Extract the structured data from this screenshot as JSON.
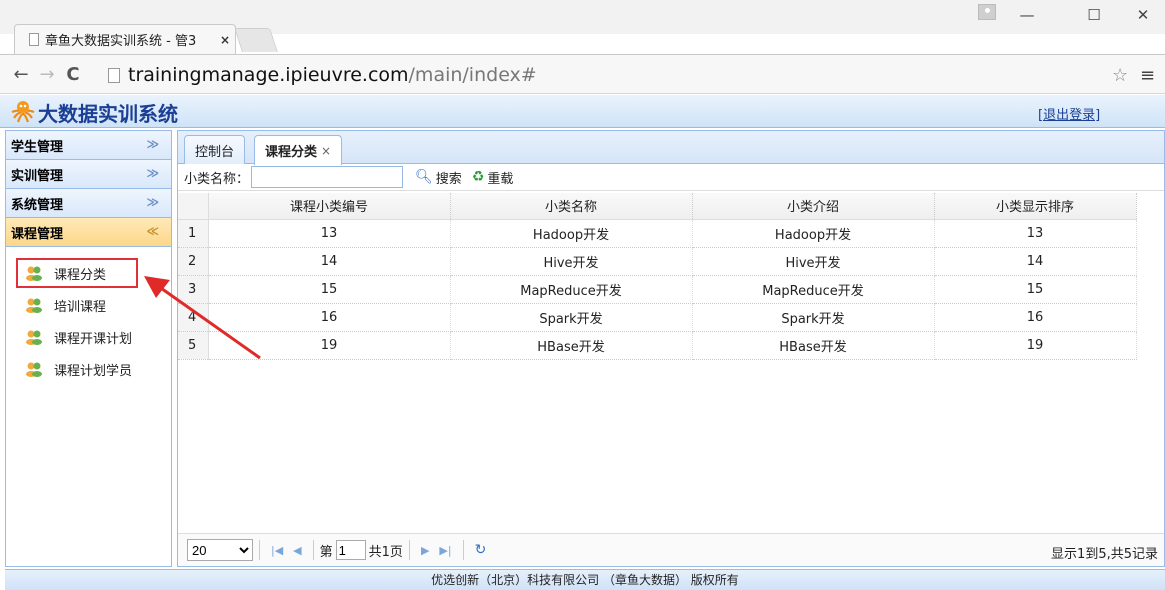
{
  "browser": {
    "tab_title": "章鱼大数据实训系统 - 管3",
    "tab_close": "×",
    "url_host": "trainingmanage.ipieuvre.com",
    "url_path": "/main/index#",
    "window_controls": [
      "—",
      "☐",
      "✕"
    ]
  },
  "app": {
    "title": "大数据实训系统",
    "logout": "[退出登录]"
  },
  "sidebar": {
    "sections": [
      {
        "label": "学生管理",
        "chevron": "≫"
      },
      {
        "label": "实训管理",
        "chevron": "≫"
      },
      {
        "label": "系统管理",
        "chevron": "≫"
      },
      {
        "label": "课程管理",
        "chevron": "≪"
      }
    ],
    "items": [
      {
        "label": "课程分类"
      },
      {
        "label": "培训课程"
      },
      {
        "label": "课程开课计划"
      },
      {
        "label": "课程计划学员"
      }
    ]
  },
  "tabs": [
    {
      "label": "控制台"
    },
    {
      "label": "课程分类",
      "close": "×"
    }
  ],
  "toolbar": {
    "field_label": "小类名称：",
    "field_value": "",
    "search_label": "搜索",
    "reset_label": "重载"
  },
  "grid": {
    "columns": [
      "课程小类编号",
      "小类名称",
      "小类介绍",
      "小类显示排序"
    ],
    "rows": [
      {
        "n": "1",
        "id": "13",
        "name": "Hadoop开发",
        "desc": "Hadoop开发",
        "order": "13"
      },
      {
        "n": "2",
        "id": "14",
        "name": "Hive开发",
        "desc": "Hive开发",
        "order": "14"
      },
      {
        "n": "3",
        "id": "15",
        "name": "MapReduce开发",
        "desc": "MapReduce开发",
        "order": "15"
      },
      {
        "n": "4",
        "id": "16",
        "name": "Spark开发",
        "desc": "Spark开发",
        "order": "16"
      },
      {
        "n": "5",
        "id": "19",
        "name": "HBase开发",
        "desc": "HBase开发",
        "order": "19"
      }
    ]
  },
  "pager": {
    "page_size": "20",
    "page_prefix": "第",
    "page_value": "1",
    "page_total": "共1页",
    "info": "显示1到5,共5记录"
  },
  "footer": {
    "text": "优选创新（北京）科技有限公司 （章鱼大数据） 版权所有"
  }
}
